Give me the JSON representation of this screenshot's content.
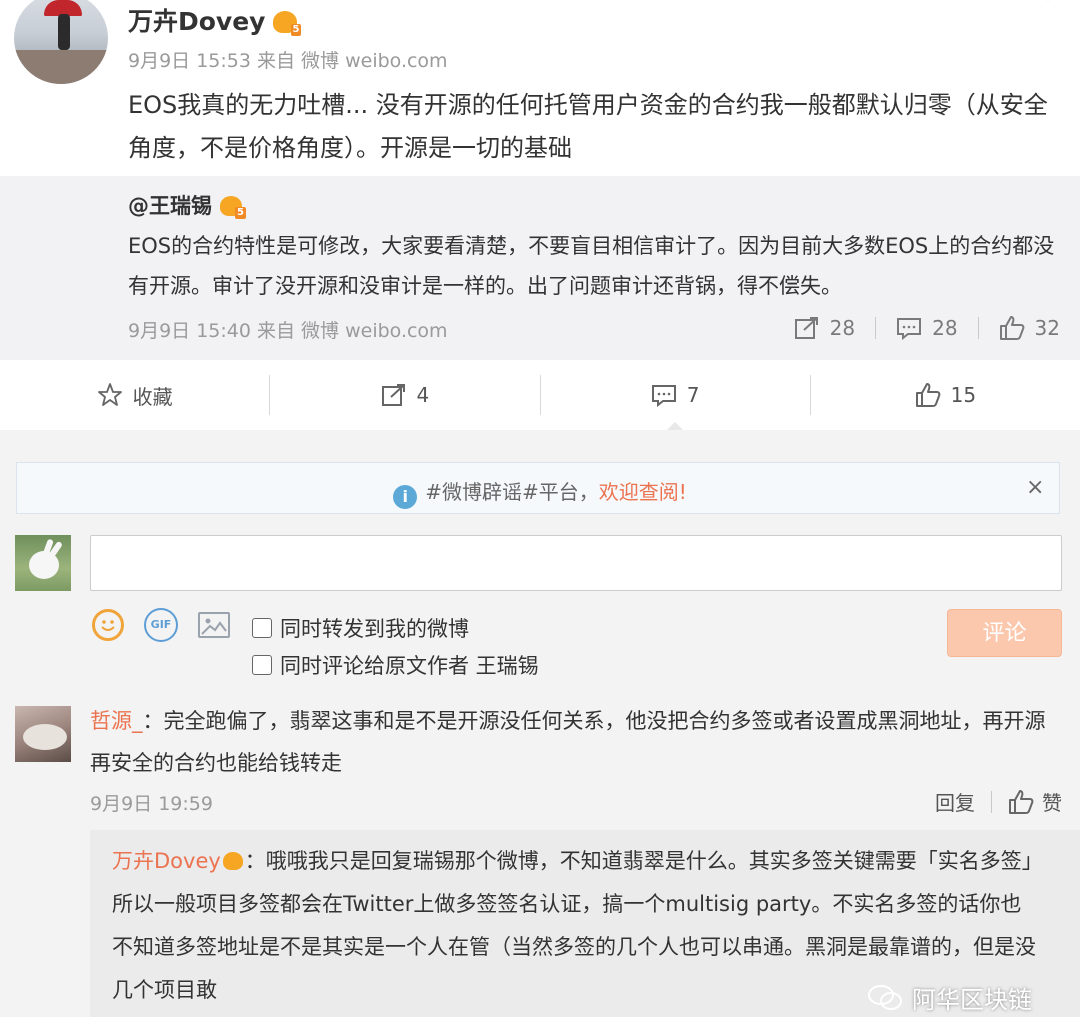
{
  "post": {
    "author": "万卉Dovey",
    "meta": "9月9日 15:53 来自 微博 weibo.com",
    "text": "EOS我真的无力吐槽... 没有开源的任何托管用户资金的合约我一般都默认归零（从安全角度，不是价格角度）。开源是一切的基础"
  },
  "quoted": {
    "author": "@王瑞锡",
    "text": "EOS的合约特性是可修改，大家要看清楚，不要盲目相信审计了。因为目前大多数EOS上的合约都没有开源。审计了没开源和没审计是一样的。出了问题审计还背锅，得不偿失。",
    "meta": "9月9日 15:40 来自 微博 weibo.com",
    "repost_count": "28",
    "comment_count": "28",
    "like_count": "32"
  },
  "actions": {
    "favorite_label": "收藏",
    "repost_count": "4",
    "comment_count": "7",
    "like_count": "15"
  },
  "notice": {
    "text": "#微博辟谣#平台，",
    "highlight": "欢迎查阅!",
    "close": "×"
  },
  "composer": {
    "gif_label": "GIF",
    "repost_checkbox": "同时转发到我的微博",
    "comment_original_checkbox": "同时评论给原文作者 王瑞锡",
    "submit_label": "评论"
  },
  "comment": {
    "author": "哲源_",
    "separator": "：",
    "text": "完全跑偏了，翡翠这事和是不是开源没任何关系，他没把合约多签或者设置成黑洞地址，再开源再安全的合约也能给钱转走",
    "time": "9月9日 19:59",
    "reply_label": "回复",
    "like_label": "赞"
  },
  "reply": {
    "author": "万卉Dovey",
    "separator": "：",
    "text": "哦哦我只是回复瑞锡那个微博，不知道翡翠是什么。其实多签关键需要「实名多签」所以一般项目多签都会在Twitter上做多签签名认证，搞一个multisig party。不实名多签的话你也不知道多签地址是不是其实是一个人在管（当然多签的几个人也可以串通。黑洞是最靠谱的，但是没几个项目敢"
  },
  "watermark": "阿华区块链",
  "colors": {
    "accent": "#eb7350",
    "meta_gray": "#9a9a9a",
    "submit_disabled": "#fbc8ae",
    "info_blue": "#5ca9d8",
    "vip_gold": "#f6a623"
  }
}
